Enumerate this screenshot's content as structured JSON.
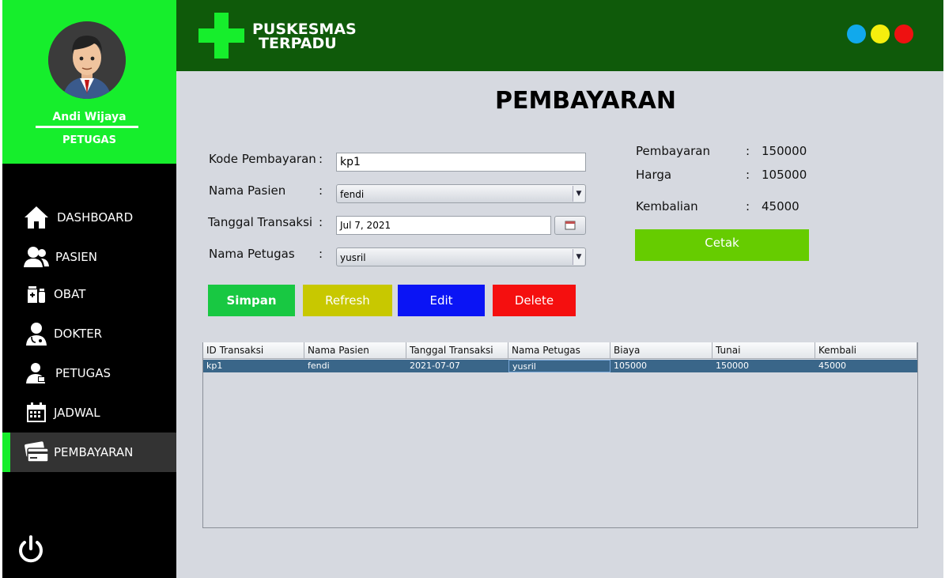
{
  "sidebar": {
    "user_name": "Andi Wijaya",
    "user_role": "PETUGAS",
    "items": [
      {
        "label": "DASHBOARD",
        "icon": "home-icon"
      },
      {
        "label": "PASIEN",
        "icon": "users-icon"
      },
      {
        "label": "OBAT",
        "icon": "medicine-icon"
      },
      {
        "label": "DOKTER",
        "icon": "doctor-icon"
      },
      {
        "label": "PETUGAS",
        "icon": "staff-icon"
      },
      {
        "label": "JADWAL",
        "icon": "calendar-icon"
      },
      {
        "label": "PEMBAYARAN",
        "icon": "payment-card-icon",
        "active": true
      }
    ],
    "power_icon": "power-icon"
  },
  "header": {
    "brand_line1": "PUSKESMAS",
    "brand_line2": "TERPADU",
    "logo_icon": "medical-cross-icon",
    "window_dots": [
      "#11a9ec",
      "#f5ee0e",
      "#ee1111"
    ]
  },
  "page": {
    "title": "PEMBAYARAN"
  },
  "form": {
    "kode_label": "Kode Pembayaran",
    "kode_value": "kp1",
    "pasien_label": "Nama Pasien",
    "pasien_value": "fendi",
    "tanggal_label": "Tanggal Transaksi",
    "tanggal_value": "Jul 7, 2021",
    "petugas_label": "Nama Petugas",
    "petugas_value": "yusril",
    "colon": ":"
  },
  "buttons": {
    "simpan": "Simpan",
    "refresh": "Refresh",
    "edit": "Edit",
    "delete": "Delete",
    "cetak": "Cetak"
  },
  "summary": {
    "pembayaran_label": "Pembayaran",
    "pembayaran_value": "150000",
    "harga_label": "Harga",
    "harga_value": "105000",
    "kembalian_label": "Kembalian",
    "kembalian_value": "45000"
  },
  "table": {
    "columns": [
      "ID Transaksi",
      "Nama Pasien",
      "Tanggal Transaksi",
      "Nama Petugas",
      "Biaya",
      "Tunai",
      "Kembali"
    ],
    "rows": [
      [
        "kp1",
        "fendi",
        "2021-07-07",
        "yusril",
        "105000",
        "150000",
        "45000"
      ]
    ]
  },
  "colors": {
    "sidebar_green": "#16ee2c",
    "header_green": "#0f5a0a",
    "simpan": "#18c842",
    "refresh": "#c8c800",
    "edit": "#0a14f5",
    "delete": "#f50f0f",
    "cetak": "#66cc00"
  }
}
